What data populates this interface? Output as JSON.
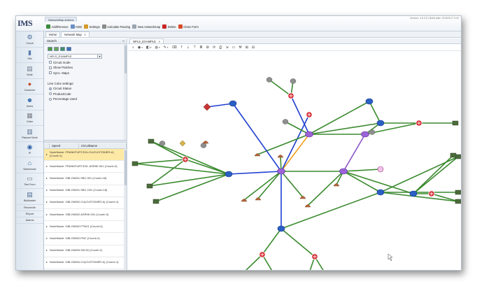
{
  "app": {
    "logo": "IMS",
    "version": "Version: 4.6.0.5 | Build date: 9/15/2017 9:43"
  },
  "ribbon": {
    "title": "NetworkMap Actions",
    "buttons": [
      {
        "label": "Add/Remove",
        "icon": "add-remove-icon",
        "color": "#3c8a3c"
      },
      {
        "label": "KMZ",
        "icon": "kmz-icon",
        "color": "#6a8fc4"
      },
      {
        "label": "Settings",
        "icon": "settings-icon",
        "color": "#d59a2a"
      },
      {
        "label": "Calculate Routing",
        "icon": "calculate-routing-icon",
        "color": "#8a8a8a"
      },
      {
        "label": "New networkmap",
        "icon": "new-map-icon",
        "color": "#9aa4b0"
      },
      {
        "label": "Delete",
        "icon": "delete-icon",
        "color": "#c72626"
      },
      {
        "label": "Close Form",
        "icon": "close-form-icon",
        "color": "#d84b2a"
      }
    ]
  },
  "nav": {
    "items": [
      {
        "label": "Circuit",
        "icon": "circuit-icon",
        "glyph": "⚙",
        "color": "#4b6e9a"
      },
      {
        "label": "Site",
        "icon": "site-icon",
        "glyph": "▮",
        "color": "#5a7fb0"
      },
      {
        "label": "Node",
        "icon": "node-icon",
        "glyph": "▤",
        "color": "#6c7a8a"
      },
      {
        "label": "Customer",
        "icon": "customer-icon",
        "glyph": "●",
        "color": "#c44c2c"
      },
      {
        "label": "Users",
        "icon": "users-icon",
        "glyph": "☻",
        "color": "#3a6fb0"
      },
      {
        "label": "Order",
        "icon": "order-icon",
        "glyph": "▦",
        "color": "#7a7f88"
      },
      {
        "label": "Planned Work",
        "icon": "planned-work-icon",
        "glyph": "▥",
        "color": "#5b7391"
      },
      {
        "label": "IP",
        "icon": "ip-icon",
        "glyph": "◉",
        "color": "#2e5fa6"
      },
      {
        "label": "Warehouse",
        "icon": "warehouse-icon",
        "glyph": "⌂",
        "color": "#3e6fa8"
      },
      {
        "label": "Test Form",
        "icon": "test-form-icon",
        "glyph": "▭",
        "color": "#6b7c91"
      },
      {
        "label": "Bulkloader",
        "icon": "bulkloader-icon",
        "glyph": "▤",
        "color": "#4f6d94"
      }
    ],
    "text_items": [
      "Reconcile",
      "Report",
      "Alarms"
    ]
  },
  "tabs": [
    {
      "label": "Home"
    },
    {
      "label": "Network Map"
    }
  ],
  "search": {
    "title": "Search",
    "select_value": "NPLS_EXAMPLE",
    "checkboxes": [
      "Circuit mode",
      "Show Patches",
      "Sync. Maps"
    ],
    "line_color_title": "Line Color settings:",
    "radios": [
      {
        "label": "Circuit Status",
        "checked": true
      },
      {
        "label": "ProductCode",
        "checked": false
      },
      {
        "label": "Percentage Used",
        "checked": false
      }
    ]
  },
  "grid": {
    "columns": [
      "Speed",
      "CircuitName"
    ],
    "rows": [
      {
        "text": "NodeName: FRANKFURT/DXL/CU/CUSTOMER-A) (Count=1)",
        "selected": true
      },
      {
        "text": "NodeName: FRANKFURT/DXL.ASR9K.001 (Count=3)",
        "selected": false
      },
      {
        "text": "NodeName: GBLON001.SBC.001 (Count=18)",
        "selected": false
      },
      {
        "text": "NodeName: GBLON001.SBC.O01 (Count=18)",
        "selected": false
      },
      {
        "text": "NodeName: GBLON002.CU(CUSTOMER-A) (Count=1)",
        "selected": false
      },
      {
        "text": "NodeName: GBLON002.ASR9K.001 (Count=3)",
        "selected": false
      },
      {
        "text": "NodeName: GBLON002.PTN01 (Count=3)",
        "selected": false
      },
      {
        "text": "NodeName: GBLON002.PNC (Count=2)",
        "selected": false
      },
      {
        "text": "NodeName: GBLON003.SW.00 (Count=2)",
        "selected": false
      },
      {
        "text": "NodeName: GBLON004.CU(CUSTOMER-A) (Count=1)",
        "selected": false
      },
      {
        "text": "NodeName: GBLON004.SW.00 (Count=4)",
        "selected": false
      },
      {
        "text": "NodeName: GBLON005.SW.00 (Count=4)",
        "selected": false
      }
    ]
  },
  "map": {
    "tab_label": "NPLS_EXAMPLE",
    "toolbar_icons": [
      "zoom-icon",
      "view-icon",
      "layers-icon",
      "filter-icon",
      "draw-icon",
      "eraser-icon",
      "upload-icon",
      "download-icon",
      "tree-icon",
      "list-icon",
      "gear-icon",
      "refresh-icon",
      "print-icon",
      "export-icon",
      "page-icon",
      "tools-icon",
      "expand-icon",
      "collapse-icon"
    ],
    "colors": {
      "green": "#3a8a2e",
      "blue": "#1f3fd0",
      "orange": "#f0a020",
      "purple": "#8a55c8",
      "red": "#d4222a"
    },
    "node_types": {
      "purple-hub": "#9b63d6",
      "blue-node": "#2a5fc4",
      "red-site": "#d4222a",
      "green-box": "#4b6b3b",
      "gray-avatar": "#8f8f8f",
      "brown-cup": "#b5683a"
    }
  }
}
